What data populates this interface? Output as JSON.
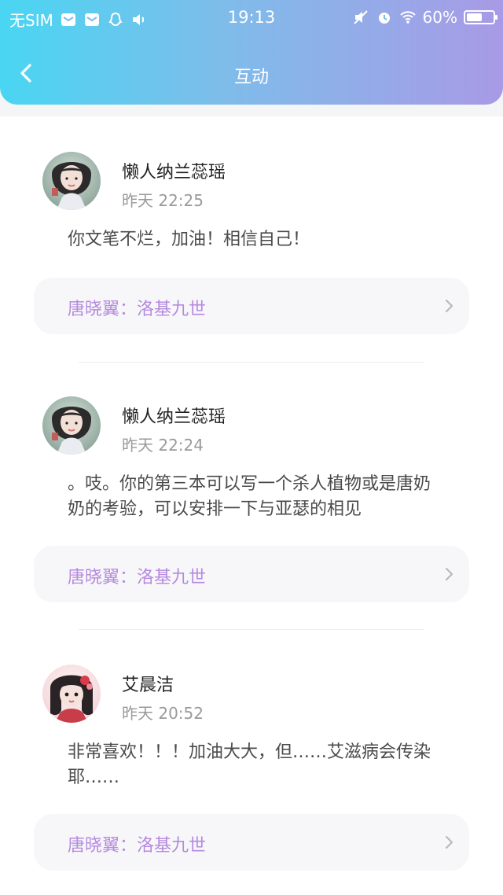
{
  "status": {
    "carrier": "无SIM",
    "time": "19:13",
    "battery_percent": "60%",
    "battery_level": 0.6
  },
  "header": {
    "title": "互动"
  },
  "comments": [
    {
      "user": "懒人纳兰蕊瑶",
      "time": "昨天 22:25",
      "text": "你文笔不烂，加油！相信自己！",
      "reply": "唐晓翼：洛基九世"
    },
    {
      "user": "懒人纳兰蕊瑶",
      "time": "昨天 22:24",
      "text": "。吱。你的第三本可以写一个杀人植物或是唐奶奶的考验，可以安排一下与亚瑟的相见",
      "reply": "唐晓翼：洛基九世"
    },
    {
      "user": "艾晨洁",
      "time": "昨天 20:52",
      "text": "非常喜欢！！！加油大大，但……艾滋病会传染耶……",
      "reply": "唐晓翼：洛基九世"
    }
  ],
  "colors": {
    "accent": "#b58adf",
    "header_left": "#49d6f2",
    "header_right": "#a89ae6"
  }
}
